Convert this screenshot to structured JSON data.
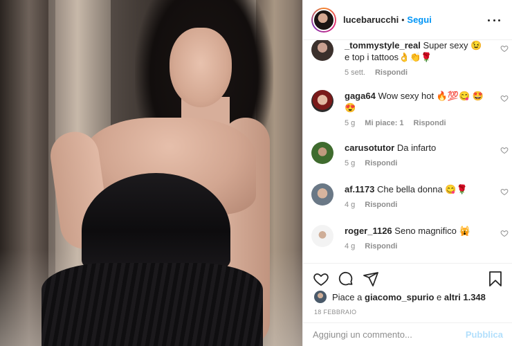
{
  "post": {
    "username": "lucebarucchi",
    "separator": "•",
    "follow_label": "Segui",
    "more_icon": "more-options-icon"
  },
  "comments": [
    {
      "user": "_tommystyle_real",
      "text": "Super sexy 😉 e top i tattoos👌👏🌹",
      "time": "5 sett.",
      "likes": "",
      "reply": "Rispondi"
    },
    {
      "user": "gaga64",
      "text": "Wow sexy hot 🔥💯😋 🤩😍",
      "time": "5 g",
      "likes": "Mi piace: 1",
      "reply": "Rispondi"
    },
    {
      "user": "carusotutor",
      "text": "Da infarto",
      "time": "5 g",
      "likes": "",
      "reply": "Rispondi"
    },
    {
      "user": "af.1173",
      "text": "Che bella donna 😋🌹",
      "time": "4 g",
      "likes": "",
      "reply": "Rispondi"
    },
    {
      "user": "roger_1126",
      "text": "Seno magnifico 🙀",
      "time": "4 g",
      "likes": "",
      "reply": "Rispondi"
    }
  ],
  "actions": {
    "like_icon": "heart-icon",
    "comment_icon": "comment-icon",
    "share_icon": "share-icon",
    "save_icon": "bookmark-icon"
  },
  "likes": {
    "prefix": "Piace a",
    "user": "giacomo_spurio",
    "connector": "e",
    "others": "altri 1.348"
  },
  "date": "18 FEBBRAIO",
  "add_comment": {
    "placeholder": "Aggiungi un commento...",
    "publish_label": "Pubblica"
  },
  "colors": {
    "accent": "#0095f6",
    "publish_disabled": "#b2dffc",
    "muted": "#8e8e8e",
    "text": "#262626"
  }
}
